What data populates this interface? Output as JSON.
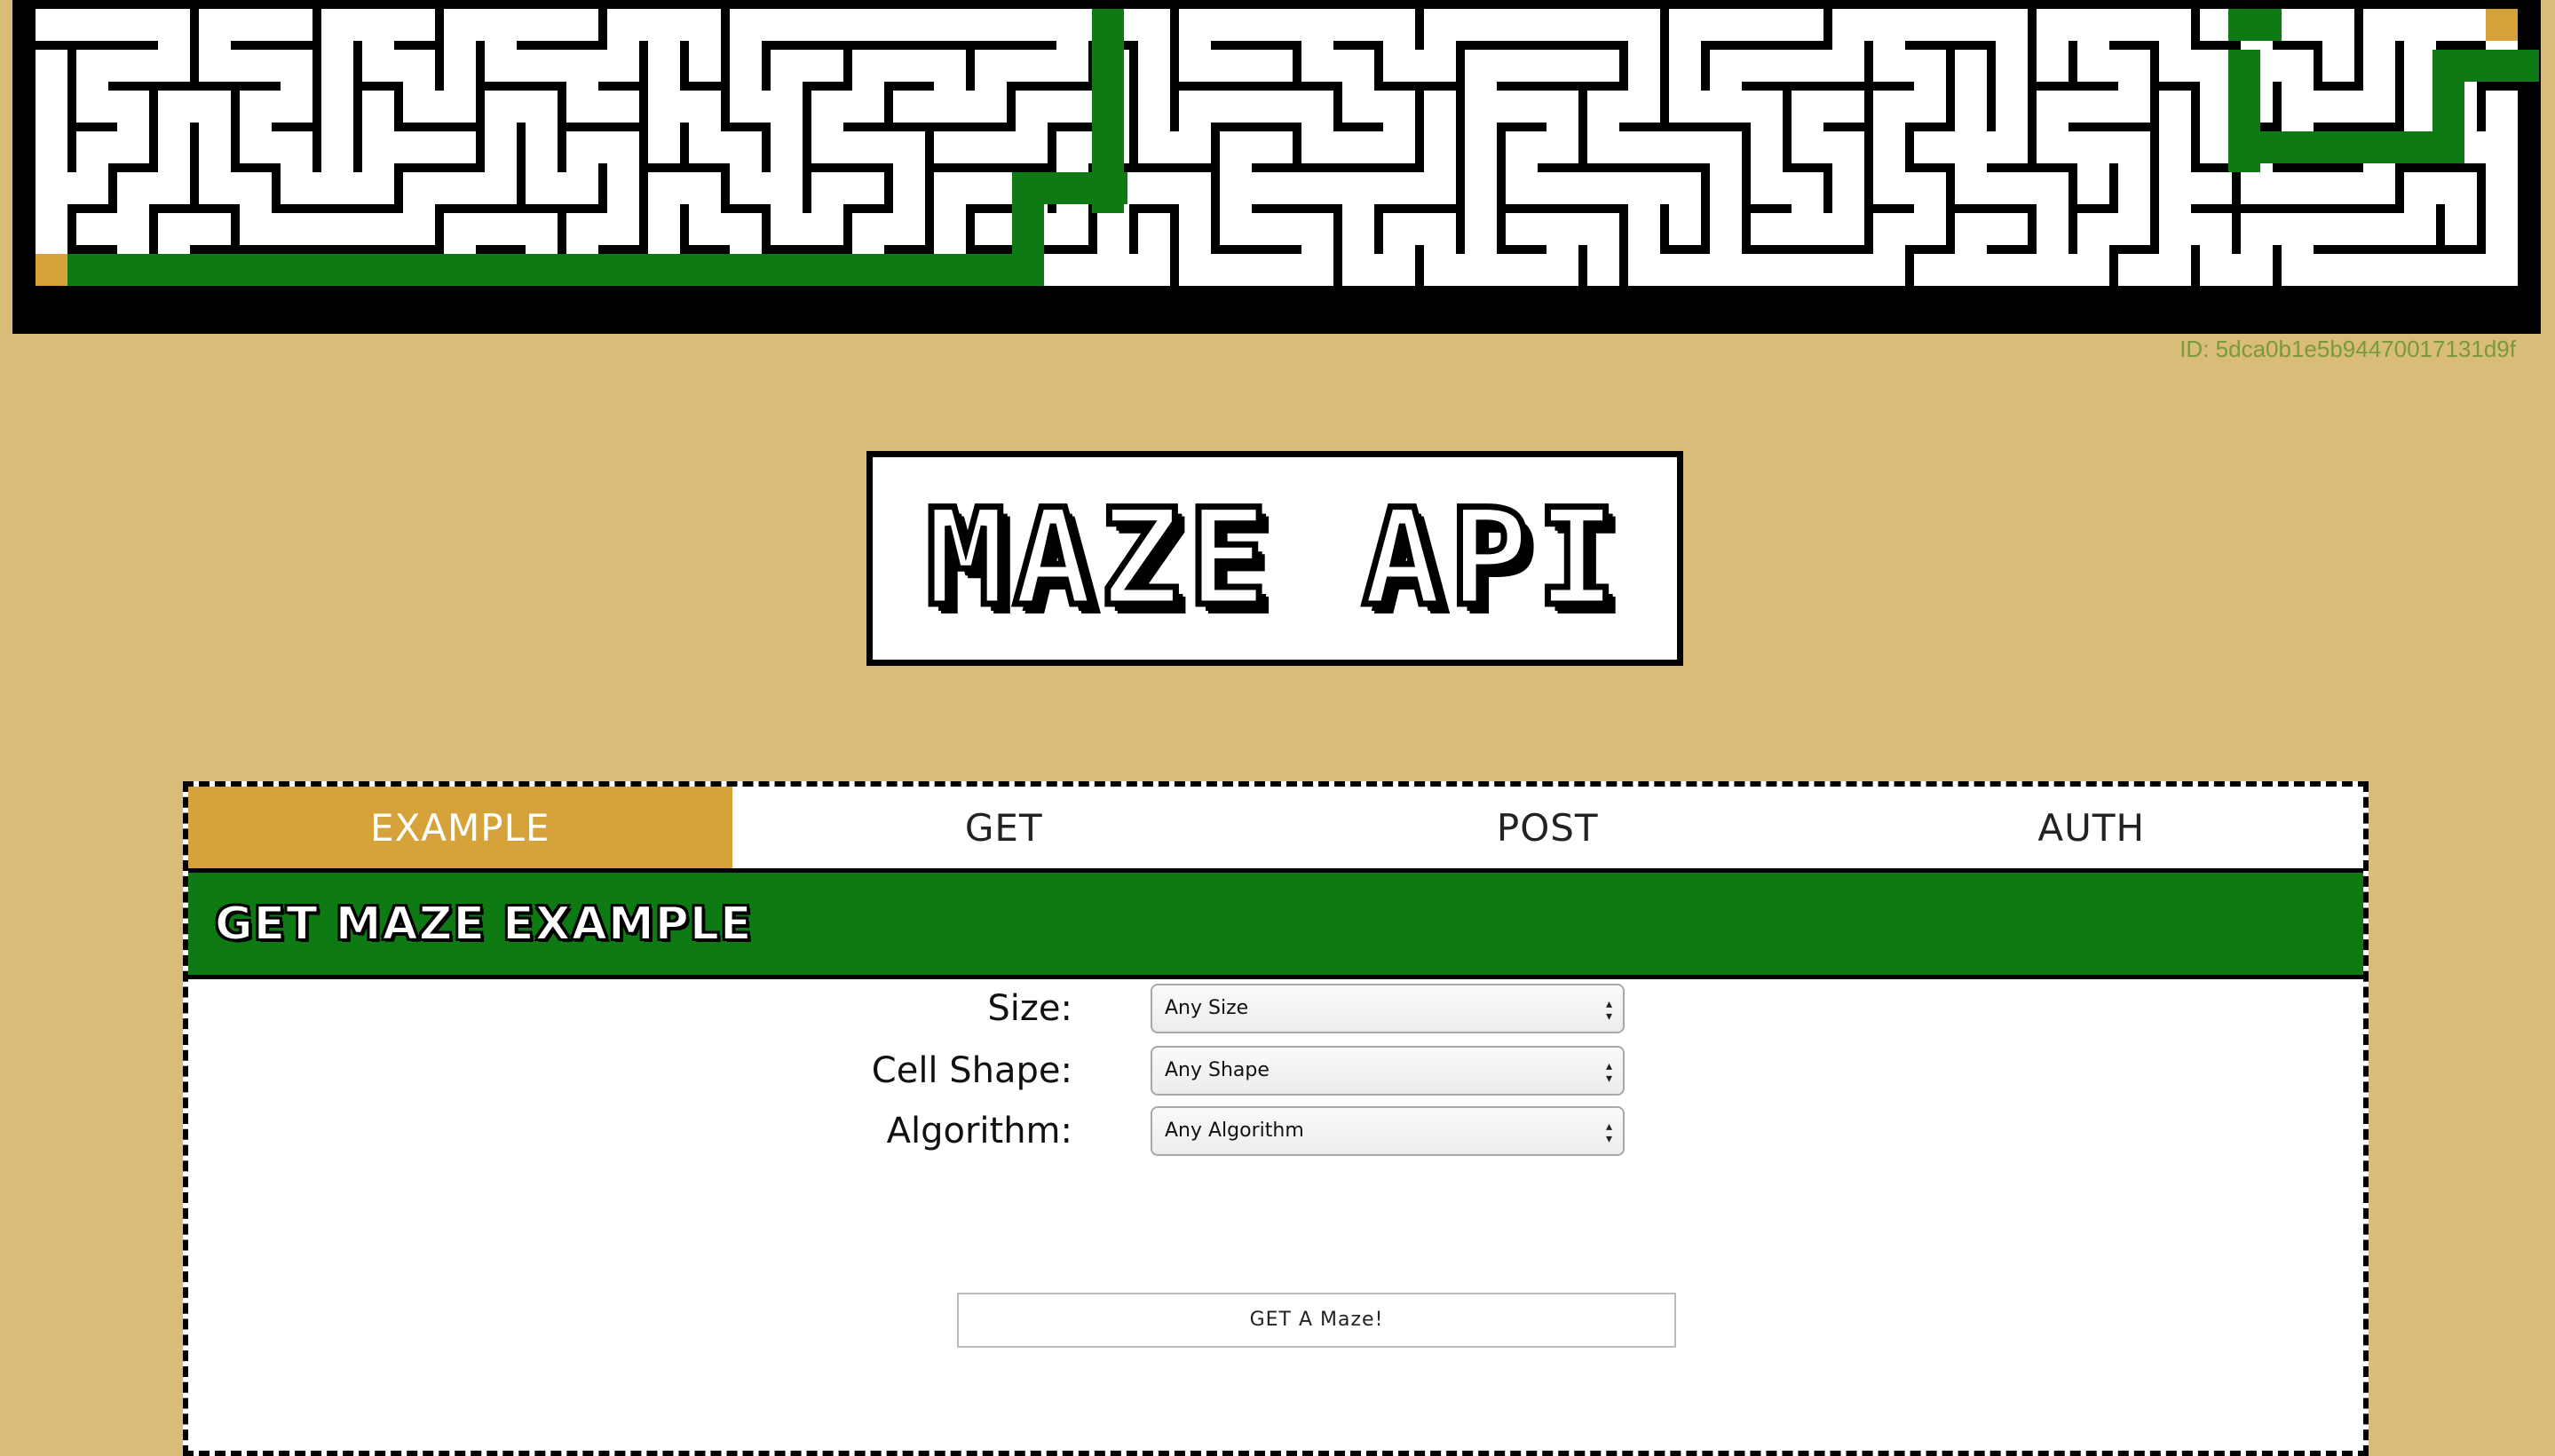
{
  "maze": {
    "id_label": "ID: 5dca0b1e5b94470017131d9f",
    "wall_color": "#000000",
    "path_color": "#ffffff",
    "solution_color": "#0e7a14",
    "endpoint_color": "#d6a23a"
  },
  "logo": {
    "text": "MAZE API"
  },
  "tabs": [
    {
      "label": "EXAMPLE",
      "active": true
    },
    {
      "label": "GET",
      "active": false
    },
    {
      "label": "POST",
      "active": false
    },
    {
      "label": "AUTH",
      "active": false
    }
  ],
  "section": {
    "title": "GET MAZE EXAMPLE"
  },
  "form": {
    "size_label": "Size:",
    "size_value": "Any Size",
    "shape_label": "Cell Shape:",
    "shape_value": "Any Shape",
    "algorithm_label": "Algorithm:",
    "algorithm_value": "Any Algorithm",
    "button_label": "GET A Maze!"
  },
  "colors": {
    "background": "#d9bc78",
    "accent": "#d6a23a",
    "header_green": "#0e7a14"
  }
}
